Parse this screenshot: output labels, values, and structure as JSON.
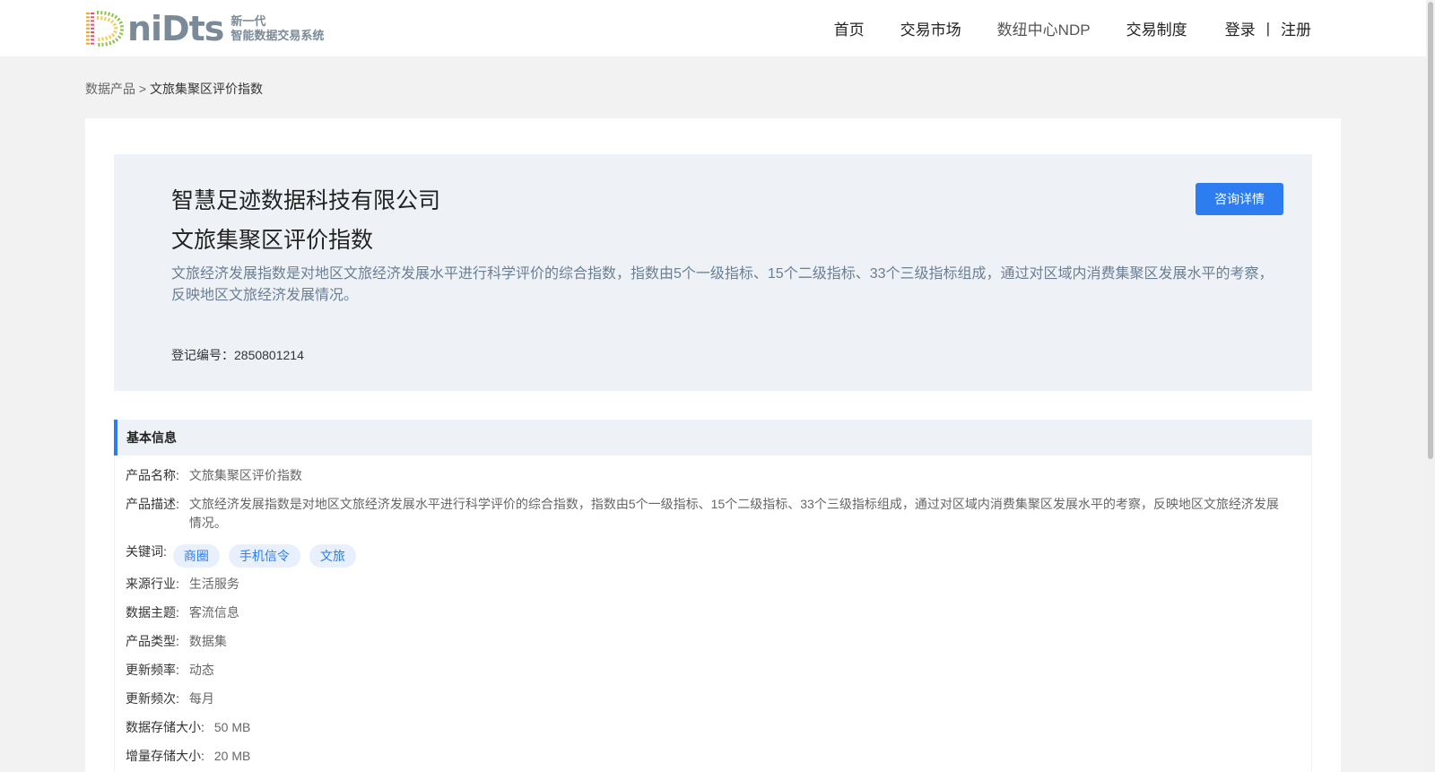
{
  "header": {
    "logo_word": "niDts",
    "logo_line1": "新一代",
    "logo_line2": "智能数据交易系统",
    "nav": [
      "首页",
      "交易市场",
      "数纽中心NDP",
      "交易制度"
    ],
    "login": "登录",
    "separator": "|",
    "register": "注册"
  },
  "breadcrumb": {
    "parent": "数据产品",
    "separator": " > ",
    "current": "文旅集聚区评价指数"
  },
  "hero": {
    "company": "智慧足迹数据科技有限公司",
    "title": "文旅集聚区评价指数",
    "description": "文旅经济发展指数是对地区文旅经济发展水平进行科学评价的综合指数，指数由5个一级指标、15个二级指标、33个三级指标组成，通过对区域内消费集聚区发展水平的考察，反映地区文旅经济发展情况。",
    "reg_label": "登记编号：",
    "reg_value": "2850801214",
    "consult_button": "咨询详情"
  },
  "info": {
    "heading": "基本信息",
    "product_name_label": "产品名称:",
    "product_name": "文旅集聚区评价指数",
    "product_desc_label": "产品描述:",
    "product_desc": "文旅经济发展指数是对地区文旅经济发展水平进行科学评价的综合指数，指数由5个一级指标、15个二级指标、33个三级指标组成，通过对区域内消费集聚区发展水平的考察，反映地区文旅经济发展情况。",
    "keywords_label": "关键词:",
    "keywords": [
      "商圈",
      "手机信令",
      "文旅"
    ],
    "industry_label": "来源行业:",
    "industry": "生活服务",
    "theme_label": "数据主题:",
    "theme": "客流信息",
    "type_label": "产品类型:",
    "type": "数据集",
    "freq_label": "更新频率:",
    "freq": "动态",
    "times_label": "更新频次:",
    "times": "每月",
    "storage_label": "数据存储大小:",
    "storage": "50 MB",
    "increment_label": "增量存储大小:",
    "increment": "20 MB"
  },
  "colors": {
    "accent": "#2d7cf0",
    "hero_bg": "#eef2f7",
    "page_bg": "#f2f2f2"
  }
}
